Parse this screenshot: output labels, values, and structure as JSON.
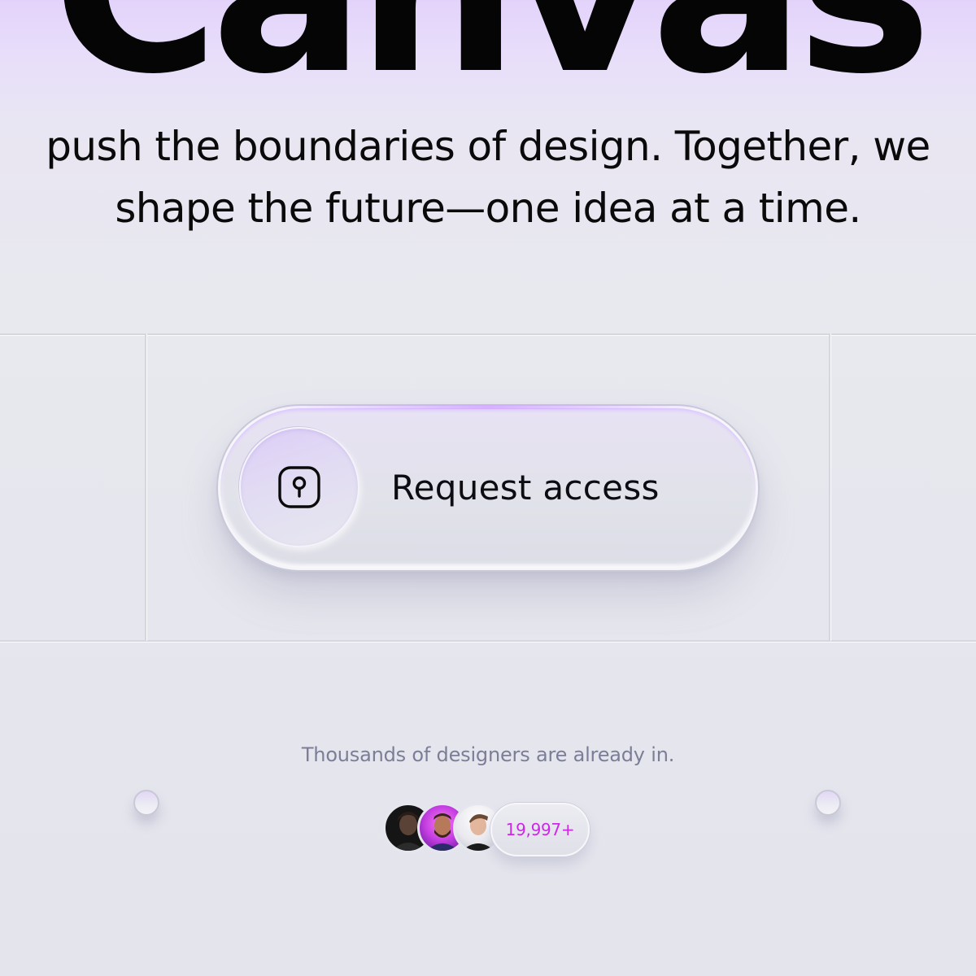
{
  "hero": {
    "word": "Canvas"
  },
  "tagline": {
    "line1": "push the boundaries of design. Together, we",
    "line2": "shape the future—one idea at a time."
  },
  "cta": {
    "label": "Request access",
    "icon": "keyhole-icon"
  },
  "social_proof": {
    "note": "Thousands of designers are already in.",
    "count": "19,997+",
    "avatars": [
      "avatar-1",
      "avatar-2",
      "avatar-3"
    ]
  },
  "colors": {
    "accent": "#cc28e6",
    "headline": "#050505",
    "muted_text": "#7b7e96"
  }
}
